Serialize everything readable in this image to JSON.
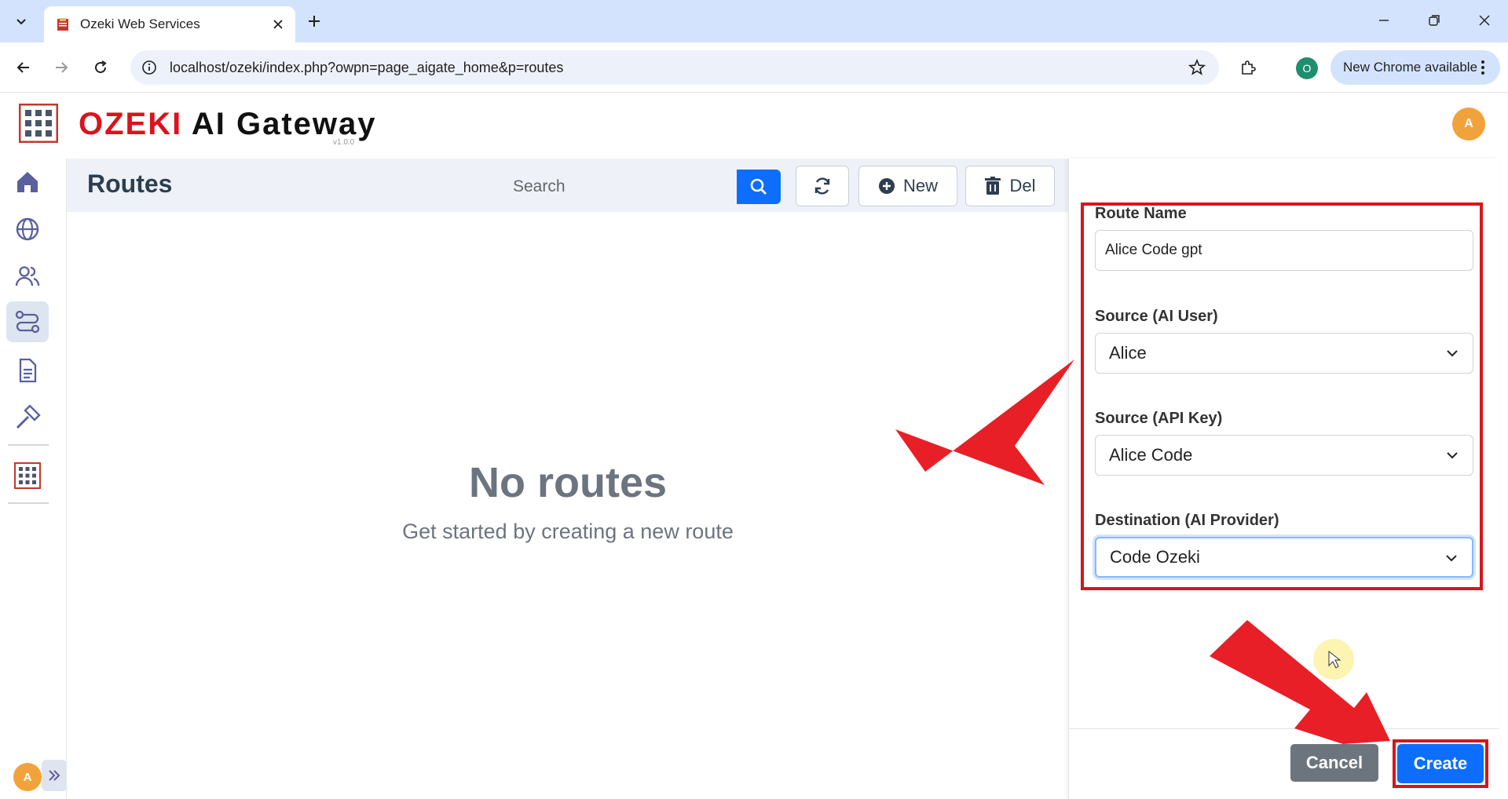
{
  "browser": {
    "tab_title": "Ozeki Web Services",
    "url": "localhost/ozeki/index.php?owpn=page_aigate_home&p=routes",
    "profile_initial": "O",
    "update_label": "New Chrome available"
  },
  "app": {
    "brand_ozeki": "OZEKI",
    "brand_rest": "AI Gateway",
    "version": "v1.0.0",
    "user_initial": "A"
  },
  "sidebar": {
    "items": [
      "home-icon",
      "globe-icon",
      "users-icon",
      "routes-icon",
      "document-icon",
      "tools-icon",
      "ozeki-grid-icon"
    ],
    "active": "routes-icon",
    "avatar_initial": "A"
  },
  "routes": {
    "title": "Routes",
    "search_placeholder": "Search",
    "new_label": "New",
    "del_label": "Del",
    "empty_title": "No routes",
    "empty_subtitle": "Get started by creating a new route"
  },
  "form": {
    "route_name_label": "Route Name",
    "route_name_value": "Alice Code gpt",
    "source_user_label": "Source (AI User)",
    "source_user_value": "Alice",
    "source_key_label": "Source (API Key)",
    "source_key_value": "Alice Code",
    "destination_label": "Destination (AI Provider)",
    "destination_value": "Code Ozeki",
    "cancel_label": "Cancel",
    "create_label": "Create"
  },
  "colors": {
    "brand_red": "#d9141c",
    "primary_blue": "#0d6efd",
    "cancel_gray": "#6c757d",
    "tab_strip": "#d3e3fd",
    "avatar_orange": "#f2a23a"
  }
}
